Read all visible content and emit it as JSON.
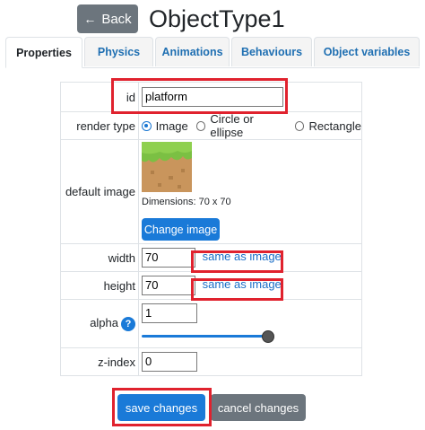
{
  "header": {
    "back_label": "Back",
    "title": "ObjectType1"
  },
  "tabs": [
    {
      "label": "Properties",
      "active": true
    },
    {
      "label": "Physics",
      "active": false
    },
    {
      "label": "Animations",
      "active": false
    },
    {
      "label": "Behaviours",
      "active": false
    },
    {
      "label": "Object variables",
      "active": false
    }
  ],
  "form": {
    "id": {
      "label": "id",
      "value": "platform"
    },
    "render_type": {
      "label": "render type",
      "options": [
        "Image",
        "Circle or ellipse",
        "Rectangle"
      ],
      "selected": "Image"
    },
    "default_image": {
      "label": "default image",
      "dimensions": "Dimensions: 70 x 70",
      "change_label": "Change image"
    },
    "width": {
      "label": "width",
      "value": "70",
      "same_as_image": "same as image"
    },
    "height": {
      "label": "height",
      "value": "70",
      "same_as_image": "same as image"
    },
    "alpha": {
      "label": "alpha",
      "help": "?",
      "value": "1",
      "slider_level": 1.0
    },
    "zindex": {
      "label": "z-index",
      "value": "0"
    }
  },
  "actions": {
    "save_label": "save changes",
    "cancel_label": "cancel changes"
  },
  "colors": {
    "primary": "#1a7ad8",
    "secondary": "#6c757d",
    "highlight": "#e0222e",
    "tab_text": "#1f6fb2"
  }
}
